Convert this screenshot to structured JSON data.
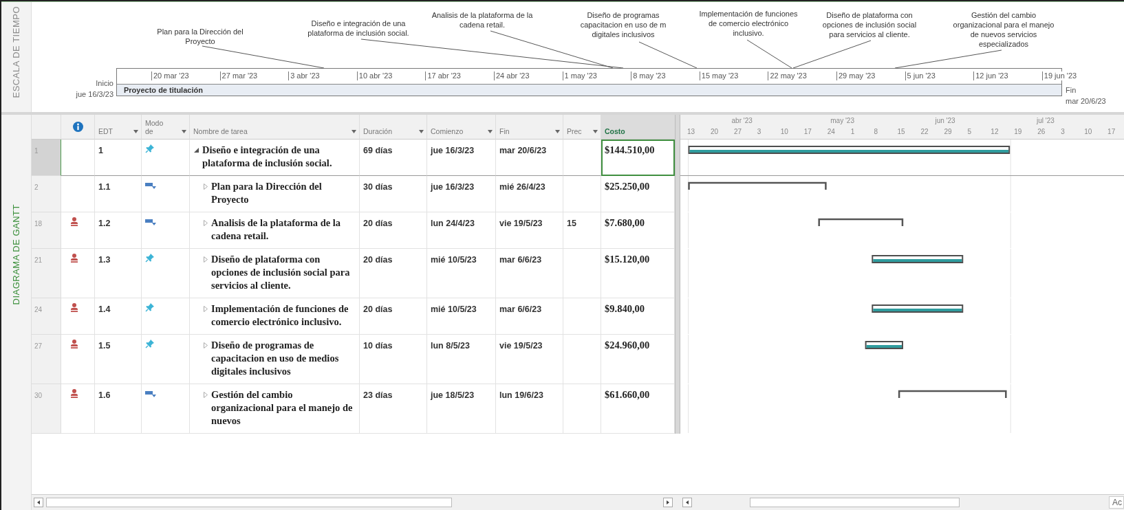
{
  "timeline": {
    "side_label": "ESCALA DE TIEMPO",
    "start_label": "Inicio",
    "start_date": "jue 16/3/23",
    "end_label": "Fin",
    "end_date": "mar 20/6/23",
    "bar_label": "Proyecto de titulación",
    "ticks": [
      "20 mar '23",
      "27 mar '23",
      "3 abr '23",
      "10 abr '23",
      "17 abr '23",
      "24 abr '23",
      "1 may '23",
      "8 may '23",
      "15 may '23",
      "22 may '23",
      "29 may '23",
      "5 jun '23",
      "12 jun '23",
      "19 jun '23"
    ],
    "callouts": [
      {
        "text": "Plan para la Dirección del\nProyecto"
      },
      {
        "text": "Diseño e integración de una\nplataforma de inclusión social."
      },
      {
        "text": "Analisis de la plataforma de la\ncadena retail."
      },
      {
        "text": "Diseño de programas\ncapacitacion en uso de m\ndigitales inclusivos"
      },
      {
        "text": "Implementación de funciones\nde comercio electrónico\ninclusivo."
      },
      {
        "text": "Diseño de plataforma con\nopciones de inclusión social\npara servicios al cliente."
      },
      {
        "text": "Gestión del cambio\norganizacional para el manejo\nde nuevos servicios\nespecializados"
      }
    ]
  },
  "gantt": {
    "side_label": "DIAGRAMA DE GANTT",
    "columns": [
      {
        "label": "EDT",
        "filter": true,
        "selected": false
      },
      {
        "label": "Modo\nde",
        "filter": true,
        "selected": false
      },
      {
        "label": "Nombre de tarea",
        "filter": true,
        "selected": false
      },
      {
        "label": "Duración",
        "filter": true,
        "selected": false
      },
      {
        "label": "Comienzo",
        "filter": true,
        "selected": false
      },
      {
        "label": "Fin",
        "filter": true,
        "selected": false
      },
      {
        "label": "Prec",
        "filter": true,
        "selected": false
      },
      {
        "label": "Costo",
        "filter": false,
        "selected": true
      }
    ],
    "tasks": [
      {
        "row": "1",
        "indicator": false,
        "edt": "1",
        "kind": "manual",
        "expanded": true,
        "selected": true,
        "name": "Diseño e integración de una plataforma de inclusión social.",
        "duration": "69 días",
        "start": "jue 16/3/23",
        "finish": "mar 20/6/23",
        "cost": "$144.510,00",
        "children": [
          {
            "row": "2",
            "indicator": false,
            "edt": "1.1",
            "kind": "auto",
            "expanded": false,
            "selected": false,
            "name": "Plan para la Dirección del Proyecto",
            "duration": "30 días",
            "start": "jue 16/3/23",
            "finish": "mié 26/4/23",
            "cost": "$25.250,00"
          },
          {
            "row": "18",
            "indicator": true,
            "edt": "1.2",
            "kind": "auto",
            "expanded": false,
            "selected": false,
            "name": "Analisis de la plataforma de la cadena retail.",
            "duration": "20 días",
            "start": "lun 24/4/23",
            "finish": "vie 19/5/23",
            "pred": "15",
            "cost": "$7.680,00"
          },
          {
            "row": "21",
            "indicator": true,
            "edt": "1.3",
            "kind": "manual",
            "expanded": false,
            "selected": false,
            "name": "Diseño de plataforma con opciones de inclusión social para servicios al cliente.",
            "duration": "20 días",
            "start": "mié 10/5/23",
            "finish": "mar 6/6/23",
            "cost": "$15.120,00"
          },
          {
            "row": "24",
            "indicator": true,
            "edt": "1.4",
            "kind": "manual",
            "expanded": false,
            "selected": false,
            "name": "Implementación de funciones de comercio electrónico inclusivo.",
            "duration": "20 días",
            "start": "mié 10/5/23",
            "finish": "mar 6/6/23",
            "cost": "$9.840,00"
          },
          {
            "row": "27",
            "indicator": true,
            "edt": "1.5",
            "kind": "manual",
            "expanded": false,
            "selected": false,
            "name": "Diseño de programas de capacitacion en uso de medios digitales inclusivos",
            "duration": "10 días",
            "start": "lun 8/5/23",
            "finish": "vie 19/5/23",
            "cost": "$24.960,00"
          },
          {
            "row": "30",
            "indicator": true,
            "edt": "1.6",
            "kind": "auto",
            "expanded": false,
            "selected": false,
            "name": "Gestión del cambio organizacional para el manejo de nuevos",
            "duration": "23 días",
            "start": "jue 18/5/23",
            "finish": "lun 19/6/23",
            "cost": "$61.660,00"
          }
        ]
      }
    ],
    "months": [
      "abr '23",
      "may '23",
      "jun '23",
      "jul '23"
    ],
    "days": [
      "13",
      "20",
      "27",
      "3",
      "10",
      "17",
      "24",
      "1",
      "8",
      "15",
      "22",
      "29",
      "5",
      "12",
      "19",
      "26",
      "3",
      "10",
      "17"
    ]
  },
  "corner_text": "Ac"
}
